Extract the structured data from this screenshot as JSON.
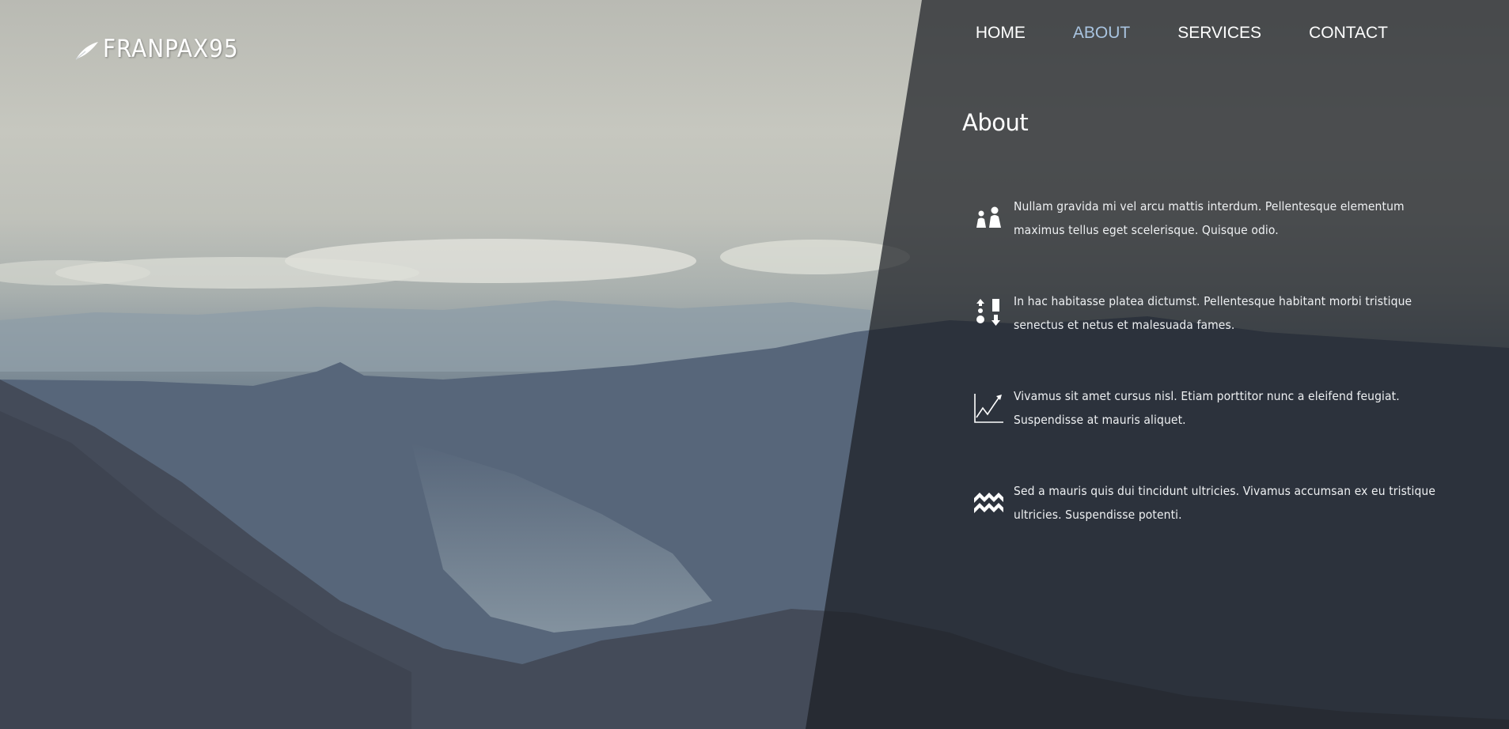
{
  "brand": {
    "name": "FRANPAX95",
    "icon": "feather-icon"
  },
  "nav": {
    "items": [
      {
        "label": "HOME",
        "active": false
      },
      {
        "label": "ABOUT",
        "active": true
      },
      {
        "label": "SERVICES",
        "active": false
      },
      {
        "label": "CONTACT",
        "active": false
      }
    ]
  },
  "about": {
    "title": "About",
    "features": [
      {
        "icon": "people-icon",
        "text": "Nullam gravida mi vel arcu mattis interdum. Pellentesque elementum maximus tellus eget scelerisque. Quisque odio."
      },
      {
        "icon": "sort-icon",
        "text": "In hac habitasse platea dictumst. Pellentesque habitant morbi tristique senectus et netus et malesuada fames."
      },
      {
        "icon": "trend-chart-icon",
        "text": "Vivamus sit amet cursus nisl. Etiam porttitor nunc a eleifend feugiat. Suspendisse at mauris aliquet."
      },
      {
        "icon": "aquarius-icon",
        "text": "Sed a mauris quis dui tincidunt ultricies. Vivamus accumsan ex eu tristique ultricies. Suspendisse potenti."
      }
    ]
  },
  "colors": {
    "nav_active": "#a9c4e0",
    "text": "#ffffff",
    "overlay": "#1c1f24"
  }
}
